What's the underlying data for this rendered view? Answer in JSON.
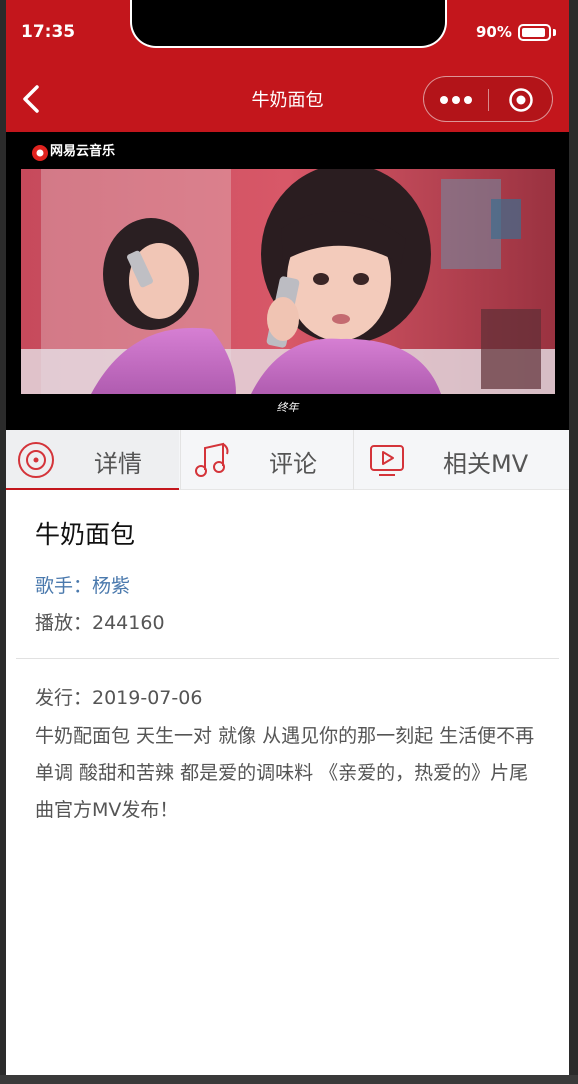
{
  "status": {
    "time": "17:35",
    "battery_percent": "90%",
    "battery_level": 0.9
  },
  "nav": {
    "title": "牛奶面包",
    "back_icon": "chevron-left-icon",
    "more_icon": "more-dots-icon",
    "close_icon": "target-circle-icon"
  },
  "video": {
    "logo_text": "网易云音乐",
    "subtitle": "终年"
  },
  "tabs": [
    {
      "label": "详情",
      "icon": "disc-icon",
      "active": true
    },
    {
      "label": "评论",
      "icon": "music-note-icon",
      "active": false
    },
    {
      "label": "相关MV",
      "icon": "video-play-icon",
      "active": false
    }
  ],
  "details": {
    "title": "牛奶面包",
    "singer": "歌手：杨紫",
    "plays": "播放：244160",
    "release": "发行：2019-07-06",
    "description": "牛奶配面包 天生一对 就像 从遇见你的那一刻起 生活便不再单调 酸甜和苦辣 都是爱的调味料 《亲爱的，热爱的》片尾曲官方MV发布！"
  },
  "colors": {
    "accent": "#c3161c",
    "link": "#4a79ad",
    "tab_bg": "#f5f6f8"
  }
}
